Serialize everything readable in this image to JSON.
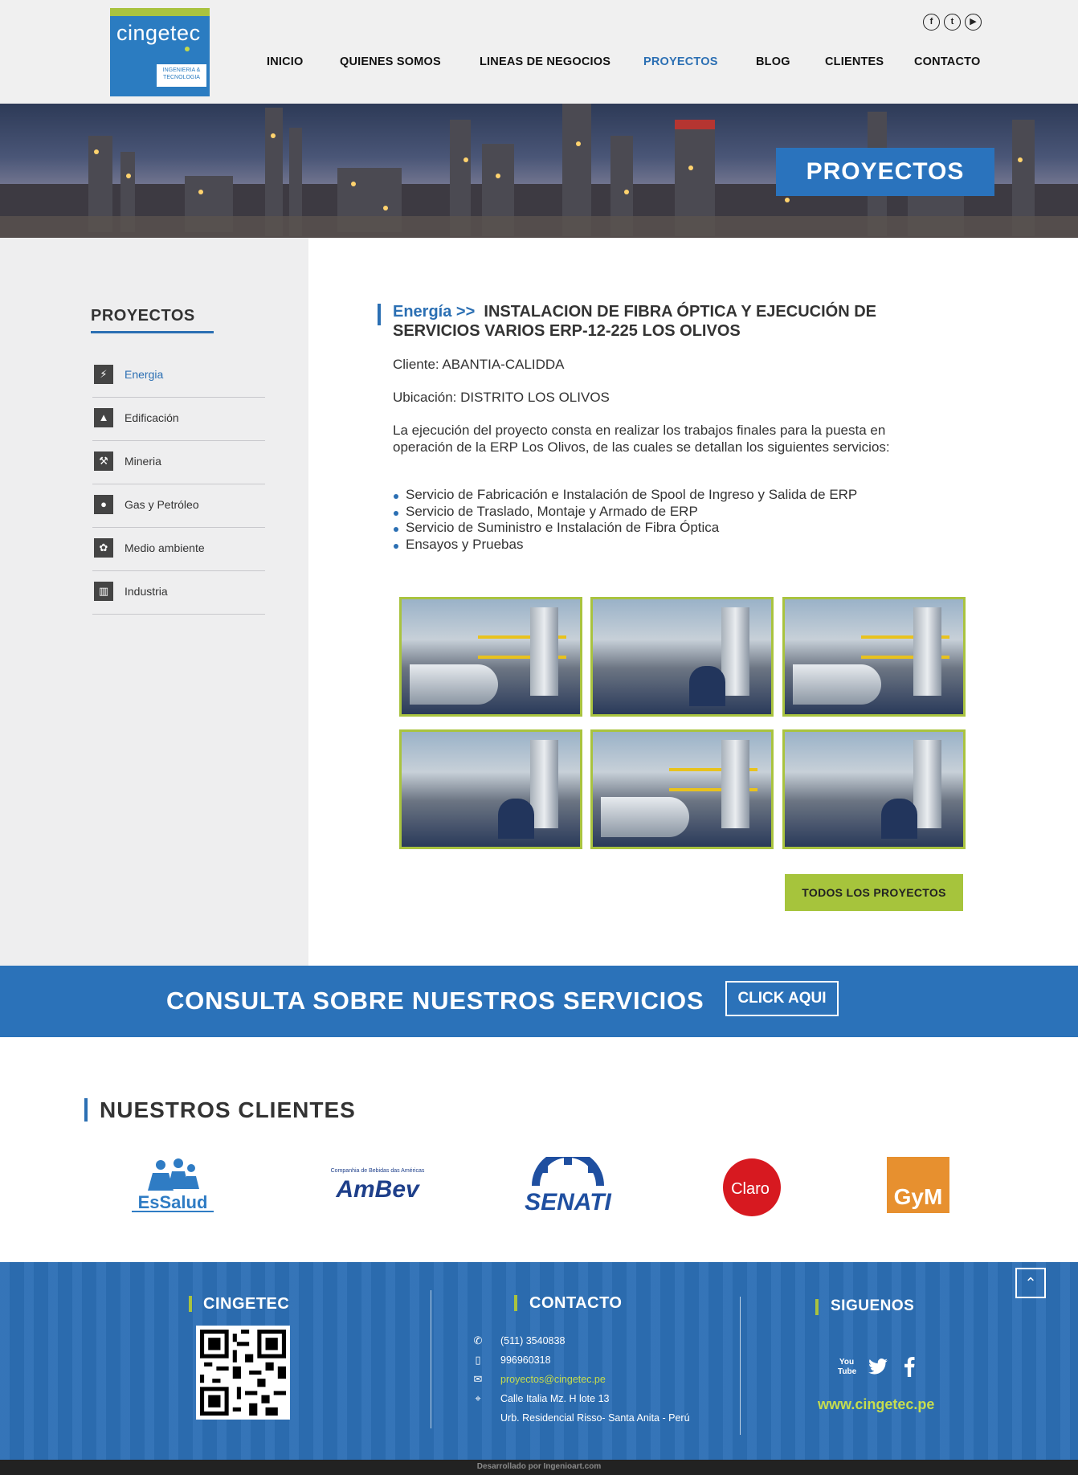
{
  "brand": {
    "logo_name": "cingetec",
    "logo_sub": "INGENIERIA & TECNOLOGIA"
  },
  "social_top": [
    "f",
    "t",
    "▶"
  ],
  "nav": [
    "INICIO",
    "QUIENES SOMOS",
    "LINEAS DE NEGOCIOS",
    "PROYECTOS",
    "BLOG",
    "CLIENTES",
    "CONTACTO"
  ],
  "banner": {
    "title": "PROYECTOS"
  },
  "sidebar": {
    "title": "PROYECTOS",
    "items": [
      {
        "label": "Energia",
        "icon": "lightning-icon"
      },
      {
        "label": "Edificación",
        "icon": "building-icon"
      },
      {
        "label": "Mineria",
        "icon": "mining-icon"
      },
      {
        "label": "Gas y Petróleo",
        "icon": "oil-drop-icon"
      },
      {
        "label": "Medio ambiente",
        "icon": "environment-icon"
      },
      {
        "label": "Industria",
        "icon": "factory-icon"
      }
    ]
  },
  "project": {
    "category": "Energía >>",
    "title": "INSTALACION DE FIBRA ÓPTICA Y EJECUCIÓN DE SERVICIOS VARIOS ERP-12-225 LOS OLIVOS",
    "client": "Cliente: ABANTIA-CALIDDA",
    "location": "Ubicación: DISTRITO LOS OLIVOS",
    "description": "La ejecución del proyecto consta en realizar los trabajos finales para la puesta en operación de la ERP Los Olivos, de las cuales se detallan los siguientes servicios:",
    "services": [
      "Servicio de Fabricación e Instalación de Spool de Ingreso y Salida de ERP",
      "Servicio de Traslado, Montaje y Armado de ERP",
      "Servicio de Suministro e Instalación de Fibra Óptica",
      "Ensayos y Pruebas"
    ],
    "all_button": "TODOS LOS PROYECTOS"
  },
  "cta": {
    "text": "CONSULTA SOBRE NUESTROS SERVICIOS",
    "button": "CLICK AQUI"
  },
  "clients": {
    "title": "NUESTROS CLIENTES",
    "logos": [
      "EsSalud",
      "AmBev",
      "SENATI",
      "Claro",
      "GyM"
    ],
    "ambev_tagline": "Companhia de Bebidas das Américas"
  },
  "footer": {
    "col1_title": "CINGETEC",
    "col2_title": "CONTACTO",
    "contact": [
      {
        "icon": "phone-icon",
        "text": "(511) 3540838"
      },
      {
        "icon": "mobile-icon",
        "text": "996960318"
      },
      {
        "icon": "mail-icon",
        "text": "proyectos@cingetec.pe"
      },
      {
        "icon": "location-icon",
        "text": "Calle Italia Mz. H lote 13"
      },
      {
        "icon": "",
        "text": "Urb. Residencial Risso- Santa Anita - Perú"
      }
    ],
    "col3_title": "SIGUENOS",
    "website": "www.cingetec.pe",
    "credits": "Desarrollado por Ingenioart.com"
  },
  "colors": {
    "brand_blue": "#2b72b9",
    "accent_green": "#a9c33f",
    "sidebar_bg": "#eeeeef"
  }
}
